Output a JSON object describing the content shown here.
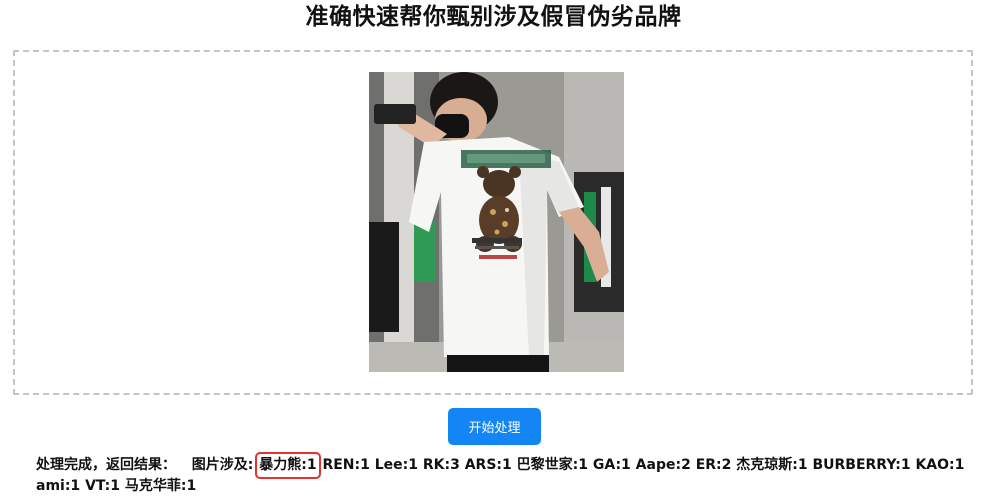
{
  "header": {
    "title": "准确快速帮你甄别涉及假冒伪劣品牌"
  },
  "upload": {
    "image_alt": "white t-shirt with bear graphic"
  },
  "actions": {
    "start_label": "开始处理"
  },
  "result": {
    "prefix": "处理完成，返回结果：",
    "involved_label": "图片涉及:",
    "highlighted_item": "暴力熊:1",
    "items": [
      "REN:1",
      "Lee:1",
      "RK:3",
      "ARS:1",
      "巴黎世家:1",
      "GA:1",
      "Aape:2",
      "ER:2",
      "杰克琼斯:1",
      "BURBERRY:1",
      "KAO:1",
      "ami:1",
      "VT:1",
      "马克华菲:1"
    ],
    "highlight_color": "#e5322c"
  },
  "theme": {
    "accent": "#1485f5",
    "dashed_border": "#c4c4c4"
  }
}
